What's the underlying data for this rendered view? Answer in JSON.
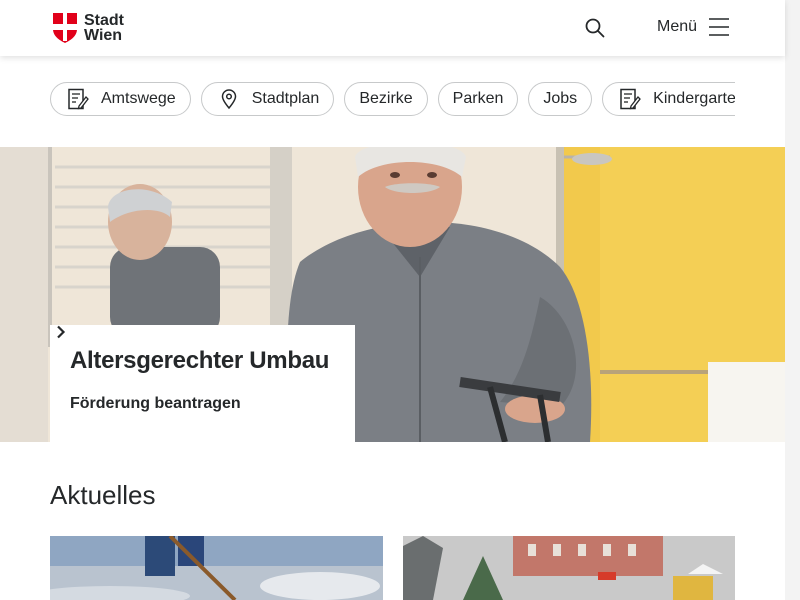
{
  "header": {
    "logo_line1": "Stadt",
    "logo_line2": "Wien",
    "search_icon": "search-icon",
    "menu_label": "Menü",
    "menu_icon": "hamburger-icon"
  },
  "quicklinks": [
    {
      "label": "Amtswege",
      "icon": "form-icon"
    },
    {
      "label": "Stadtplan",
      "icon": "map-pin-icon"
    },
    {
      "label": "Bezirke",
      "icon": ""
    },
    {
      "label": "Parken",
      "icon": ""
    },
    {
      "label": "Jobs",
      "icon": ""
    },
    {
      "label": "Kindergarten",
      "icon": "form-icon"
    }
  ],
  "hero": {
    "title": "Altersgerechter Umbau",
    "link_label": "Förderung beantragen",
    "link_icon": "chevron-right-icon"
  },
  "aktuelles": {
    "title": "Aktuelles"
  },
  "colors": {
    "brand_red": "#e1001a",
    "text": "#25282a",
    "border": "#c7c9ca",
    "hero_wall": "#f2c94c"
  }
}
